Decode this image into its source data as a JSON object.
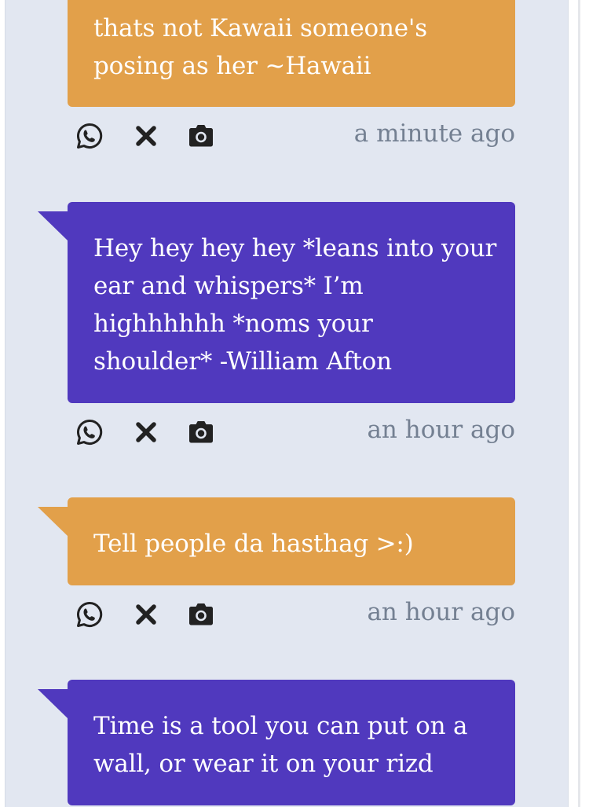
{
  "posts": [
    {
      "text": "thats not Kawaii someone's posing as her ~Hawaii",
      "time": "a minute ago",
      "color": "orange"
    },
    {
      "text": "Hey hey hey hey *leans into your ear and whispers* I’m highhhhhh *noms your shoulder* -William Afton",
      "time": "an hour ago",
      "color": "purple"
    },
    {
      "text": "Tell people da hasthag >:)",
      "time": "an hour ago",
      "color": "orange"
    },
    {
      "text": "Time is a tool you can put on a wall, or wear it on your rizd",
      "time": "",
      "color": "purple"
    }
  ],
  "icons": {
    "share": "whatsapp-icon",
    "delete": "close-icon",
    "screenshot": "camera-icon"
  },
  "colors": {
    "orange": "#e2a04a",
    "purple": "#5039be",
    "background": "#e2e7f1",
    "timestamp": "#748092"
  }
}
